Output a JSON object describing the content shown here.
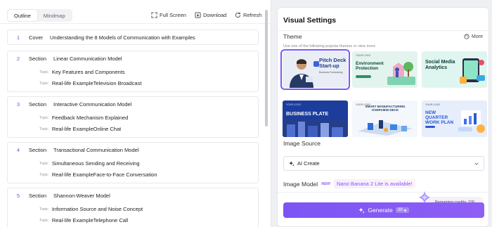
{
  "toolbar": {
    "tabs": [
      {
        "label": "Outline",
        "active": true
      },
      {
        "label": "Mindmap",
        "active": false
      }
    ],
    "full_screen": "Full Screen",
    "download": "Download",
    "refresh": "Refresh"
  },
  "outline": {
    "cover": {
      "num": "1",
      "kind": "Cover",
      "title": "Understanding the 8 Models of Communication with Examples"
    },
    "topic_label": "Topic",
    "sections": [
      {
        "num": "2",
        "kind": "Section",
        "title": "Linear Communication Model",
        "topics": [
          "Key Features and Components",
          "Real-life ExampleTelevision Broadcast"
        ]
      },
      {
        "num": "3",
        "kind": "Section",
        "title": "Interactive Communication Model",
        "topics": [
          "Feedback Mechanism Explained",
          "Real-life ExampleOnline Chat"
        ]
      },
      {
        "num": "4",
        "kind": "Section",
        "title": "Transactional Communication Model",
        "topics": [
          "Simultaneous Sending and Receiving",
          "Real-life ExampleFace-to-Face Conversation"
        ]
      },
      {
        "num": "5",
        "kind": "Section",
        "title": "Shannon-Weaver Model",
        "topics": [
          "Information Source and Noise Concept",
          "Real-life ExampleTelephone Call"
        ]
      }
    ]
  },
  "settings": {
    "title": "Visual Settings",
    "theme_label": "Theme",
    "more_label": "More",
    "theme_hint": "Use one of the following popular themes or view more",
    "themes": [
      {
        "title": "Pitch Deck Start-up",
        "sub": "Business Fundraising",
        "logo": "",
        "selected": true
      },
      {
        "title": "Environment Protection",
        "sub": "",
        "logo": "YOUR LOGO",
        "selected": false
      },
      {
        "title": "Social Media Analytics",
        "sub": "",
        "logo": "",
        "selected": false
      },
      {
        "title": "BUSINESS PLATE",
        "sub": "",
        "logo": "YOUR LOGO",
        "selected": false
      },
      {
        "title": "SMART MANUFACTURING OVERVIEW DECK",
        "sub": "",
        "logo": "YOUR LOGO",
        "selected": false
      },
      {
        "title": "NEW QUARTER WORK PLAN",
        "sub": "",
        "logo": "YOUR LOGO",
        "selected": false
      }
    ],
    "image_source_label": "Image Source",
    "image_source_value": "AI Create",
    "image_model_label": "Image Model",
    "new_badge": "NEW",
    "model_notice": "Nano Banana 2 Lite is available!",
    "credits_text": "Remaining credits: 100",
    "generate_label": "Generate",
    "generate_cost": "20"
  }
}
